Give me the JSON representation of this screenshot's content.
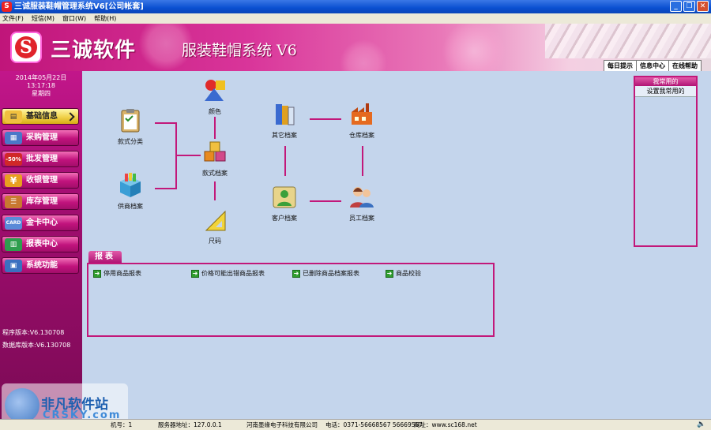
{
  "window": {
    "title": "三诚服装鞋帽管理系统V6[公司帐套]",
    "app_icon": "S"
  },
  "menu": [
    "文件(F)",
    "短信(M)",
    "窗口(W)",
    "帮助(H)"
  ],
  "banner": {
    "logo_letter": "S",
    "brand": "三诚软件",
    "product": "服装鞋帽系统 V6",
    "links": [
      "每日提示",
      "信息中心",
      "在线帮助"
    ]
  },
  "sidebar": {
    "date": "2014年05月22日",
    "time": "13:17:18",
    "weekday": "星期四",
    "items": [
      {
        "label": "基础信息",
        "icon": "clipboard-icon",
        "color": "#f0c040"
      },
      {
        "label": "采购管理",
        "icon": "purchase-icon",
        "color": "#4a78c8"
      },
      {
        "label": "批发管理",
        "icon": "discount-icon",
        "glyph": "-50%",
        "color": "#d02828"
      },
      {
        "label": "收银管理",
        "icon": "yen-icon",
        "glyph": "¥",
        "color": "#e8a020"
      },
      {
        "label": "库存管理",
        "icon": "inventory-icon",
        "color": "#c87830"
      },
      {
        "label": "金卡中心",
        "icon": "card-icon",
        "glyph": "CARD",
        "color": "#5a8ad8"
      },
      {
        "label": "报表中心",
        "icon": "report-icon",
        "color": "#2e9e4e"
      },
      {
        "label": "系统功能",
        "icon": "system-icon",
        "color": "#3a70c0"
      }
    ],
    "program_version": "程序版本:V6.130708",
    "db_version": "数据库版本:V6.130708"
  },
  "flow_nodes": [
    {
      "id": "style-category",
      "label": "款式分类",
      "icon": "clipboard-check-icon"
    },
    {
      "id": "color",
      "label": "颜色",
      "icon": "color-shapes-icon"
    },
    {
      "id": "supplier",
      "label": "供商档案",
      "icon": "box-icon"
    },
    {
      "id": "style-archive",
      "label": "款式档案",
      "icon": "cubes-icon"
    },
    {
      "id": "size",
      "label": "尺码",
      "icon": "ruler-triangle-icon"
    },
    {
      "id": "other-archive",
      "label": "其它档案",
      "icon": "books-icon"
    },
    {
      "id": "warehouse",
      "label": "仓库档案",
      "icon": "factory-icon"
    },
    {
      "id": "customer",
      "label": "客户档案",
      "icon": "customer-icon"
    },
    {
      "id": "employee",
      "label": "员工档案",
      "icon": "people-icon"
    }
  ],
  "reports": {
    "tab": "报表",
    "items": [
      "停用商品报表",
      "价格可能出错商品报表",
      "已删除商品档案报表",
      "商品校验"
    ]
  },
  "favorites": {
    "title": "我常用的",
    "items": [
      "设置我常用的"
    ]
  },
  "status": {
    "machine": "机号：1",
    "server": "服务器地址：127.0.0.1",
    "company": "河南墨缘电子科技有限公司",
    "phone": "电话：0371-56668567 56669567",
    "website": "网址：www.sc168.net"
  },
  "watermark": {
    "text": "非凡软件站",
    "sub": "CRSKY.com"
  },
  "colors": {
    "accent": "#c2187a",
    "workspace": "#c4d5ec",
    "active_nav": "#f0d14a"
  }
}
